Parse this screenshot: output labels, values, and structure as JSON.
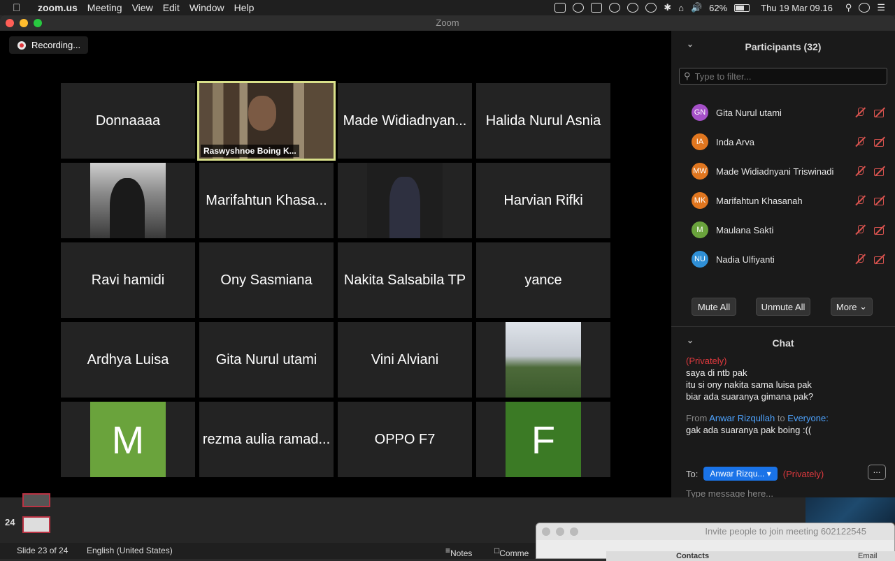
{
  "menubar": {
    "app": "zoom.us",
    "items": [
      "Meeting",
      "View",
      "Edit",
      "Window",
      "Help"
    ],
    "battery": "62%",
    "datetime": "Thu 19 Mar  09.16"
  },
  "window": {
    "title": "Zoom"
  },
  "recording": {
    "label": "Recording..."
  },
  "tiles": [
    {
      "name": "Donnaaaa",
      "kind": "text"
    },
    {
      "name": "Raswyshnoe Boing K...",
      "kind": "camera"
    },
    {
      "name": "Made Widiadnyan...",
      "kind": "text"
    },
    {
      "name": "Halida Nurul Asnia",
      "kind": "text"
    },
    {
      "name": "",
      "kind": "photo"
    },
    {
      "name": "Marifahtun Khasa...",
      "kind": "text"
    },
    {
      "name": "",
      "kind": "photo"
    },
    {
      "name": "Harvian Rifki",
      "kind": "text"
    },
    {
      "name": "Ravi hamidi",
      "kind": "text"
    },
    {
      "name": "Ony Sasmiana",
      "kind": "text"
    },
    {
      "name": "Nakita Salsabila TP",
      "kind": "text"
    },
    {
      "name": "yance",
      "kind": "text"
    },
    {
      "name": "Ardhya Luisa",
      "kind": "text"
    },
    {
      "name": "Gita Nurul utami",
      "kind": "text"
    },
    {
      "name": "Vini Alviani",
      "kind": "text"
    },
    {
      "name": "",
      "kind": "photo"
    },
    {
      "name": "M",
      "kind": "avatar",
      "color": "#6aa33c"
    },
    {
      "name": "rezma aulia ramad...",
      "kind": "text"
    },
    {
      "name": "OPPO F7",
      "kind": "text"
    },
    {
      "name": "F",
      "kind": "avatar",
      "color": "#3b7a25"
    }
  ],
  "participants": {
    "title": "Participants (32)",
    "filter_placeholder": "Type to filter...",
    "list": [
      {
        "initials": "GN",
        "name": "Gita Nurul utami",
        "color": "#a550c8"
      },
      {
        "initials": "IA",
        "name": "Inda Arva",
        "color": "#e0761f"
      },
      {
        "initials": "MW",
        "name": "Made Widiadnyani Triswinadi",
        "color": "#e0761f"
      },
      {
        "initials": "MK",
        "name": "Marifahtun Khasanah",
        "color": "#e0761f"
      },
      {
        "initials": "M",
        "name": "Maulana Sakti",
        "color": "#6aa33c"
      },
      {
        "initials": "NU",
        "name": "Nadia Ulfiyanti",
        "color": "#2f8fd6"
      }
    ],
    "mute_all": "Mute All",
    "unmute_all": "Unmute All",
    "more": "More"
  },
  "chat": {
    "title": "Chat",
    "privately_top": "(Privately)",
    "line1": "saya di ntb pak",
    "line2": "itu si ony nakita sama luisa pak",
    "line3": "biar ada suaranya gimana pak?",
    "from_label": "From",
    "from_name": "Anwar Rizqullah",
    "to_word": "to",
    "to_name": "Everyone:",
    "line4": "gak ada suaranya pak boing :((",
    "to_label": "To:",
    "recipient": "Anwar Rizqu...",
    "privately": "(Privately)",
    "more": "...",
    "input_placeholder": "Type message here..."
  },
  "ppt": {
    "slide_num": "24",
    "status": "Slide 23 of 24",
    "language": "English (United States)",
    "notes": "Notes",
    "comments": "Comme"
  },
  "invite": {
    "title": "Invite people to join meeting 602122545",
    "tab_contacts": "Contacts",
    "tab_email": "Email"
  }
}
